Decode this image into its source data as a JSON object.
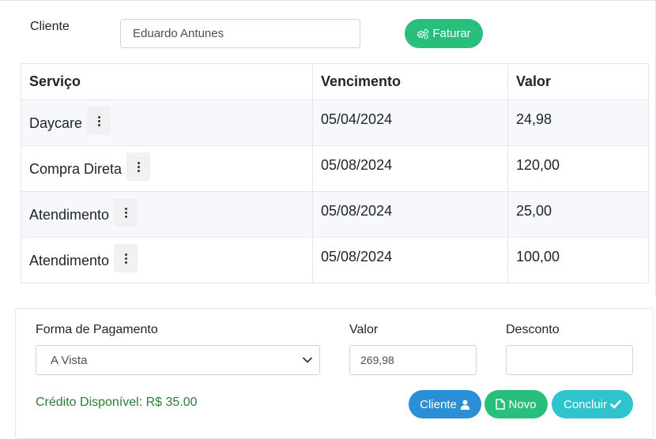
{
  "cliente": {
    "label": "Cliente",
    "value": "Eduardo Antunes",
    "faturar_label": "Faturar"
  },
  "table": {
    "headers": [
      "Serviço",
      "Vencimento",
      "Valor"
    ],
    "rows": [
      {
        "servico": "Daycare",
        "vencimento": "05/04/2024",
        "valor": "24,98"
      },
      {
        "servico": "Compra Direta",
        "vencimento": "05/08/2024",
        "valor": "120,00"
      },
      {
        "servico": "Atendimento",
        "vencimento": "05/08/2024",
        "valor": "25,00"
      },
      {
        "servico": "Atendimento",
        "vencimento": "05/08/2024",
        "valor": "100,00"
      }
    ]
  },
  "pagamento": {
    "forma_label": "Forma de Pagamento",
    "forma_value": "A Vista",
    "valor_label": "Valor",
    "valor_value": "269,98",
    "desconto_label": "Desconto",
    "desconto_value": "",
    "credito_text": "Crédito Disponível: R$ 35.00",
    "cliente_btn": "Cliente",
    "novo_btn": "Novo",
    "concluir_btn": "Concluir"
  },
  "colors": {
    "green": "#28be7c",
    "blue": "#2b8fd6",
    "teal": "#2ec3cd",
    "credit_text": "#2e7d32"
  },
  "icons": {
    "faturar": "gears-icon",
    "row_menu": "vertical-ellipsis-icon",
    "select": "chevron-down-icon",
    "cliente": "user-icon",
    "novo": "file-icon",
    "concluir": "check-icon"
  }
}
